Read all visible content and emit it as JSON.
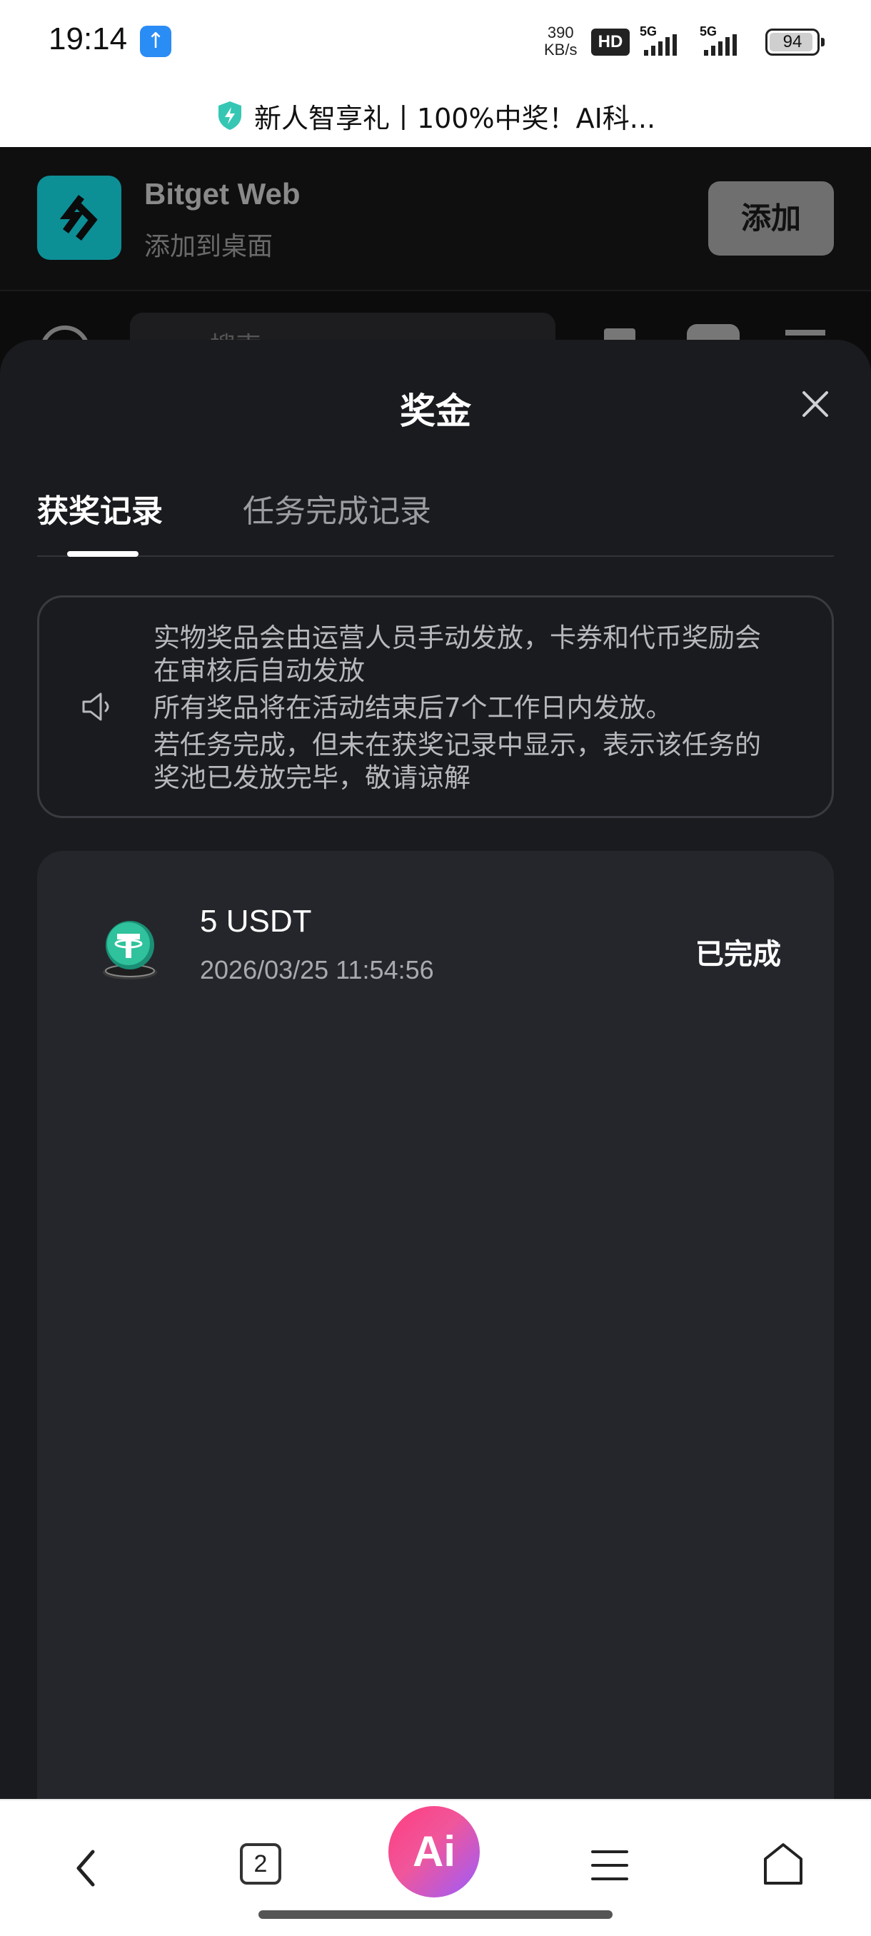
{
  "status_bar": {
    "time": "19:14",
    "net_speed_value": "390",
    "net_speed_unit": "KB/s",
    "hd_label": "HD",
    "signal_1_label": "5G",
    "signal_2_label": "5G",
    "battery": "94",
    "battery_level": 0.94
  },
  "promo_banner": {
    "text": "新人智享礼丨100%中奖！AI科..."
  },
  "install_prompt": {
    "app_name": "Bitget Web",
    "subtitle": "添加到桌面",
    "add_label": "添加"
  },
  "page_toolbar": {
    "search_placeholder": "搜索"
  },
  "sheet": {
    "title": "奖金",
    "tabs": [
      {
        "label": "获奖记录",
        "active": true
      },
      {
        "label": "任务完成记录",
        "active": false
      }
    ],
    "notice": {
      "lines": [
        "实物奖品会由运营人员手动发放，卡券和代币奖励会在审核后自动发放",
        "所有奖品将在活动结束后7个工作日内发放。",
        "若任务完成，但未在获奖记录中显示，表示该任务的奖池已发放完毕，敬请谅解"
      ]
    },
    "records": [
      {
        "amount": "5 USDT",
        "time": "2026/03/25 11:54:56",
        "status": "已完成",
        "icon": "usdt-coin-icon"
      }
    ]
  },
  "bottom_nav": {
    "tab_count": "2",
    "ai_label": "Ai",
    "accent_gradient": [
      "#ff3d7f",
      "#9a5cff"
    ]
  },
  "colors": {
    "sheet_bg": "#1a1b1e",
    "card_bg": "#25262b",
    "teal": "#0d8f96"
  }
}
